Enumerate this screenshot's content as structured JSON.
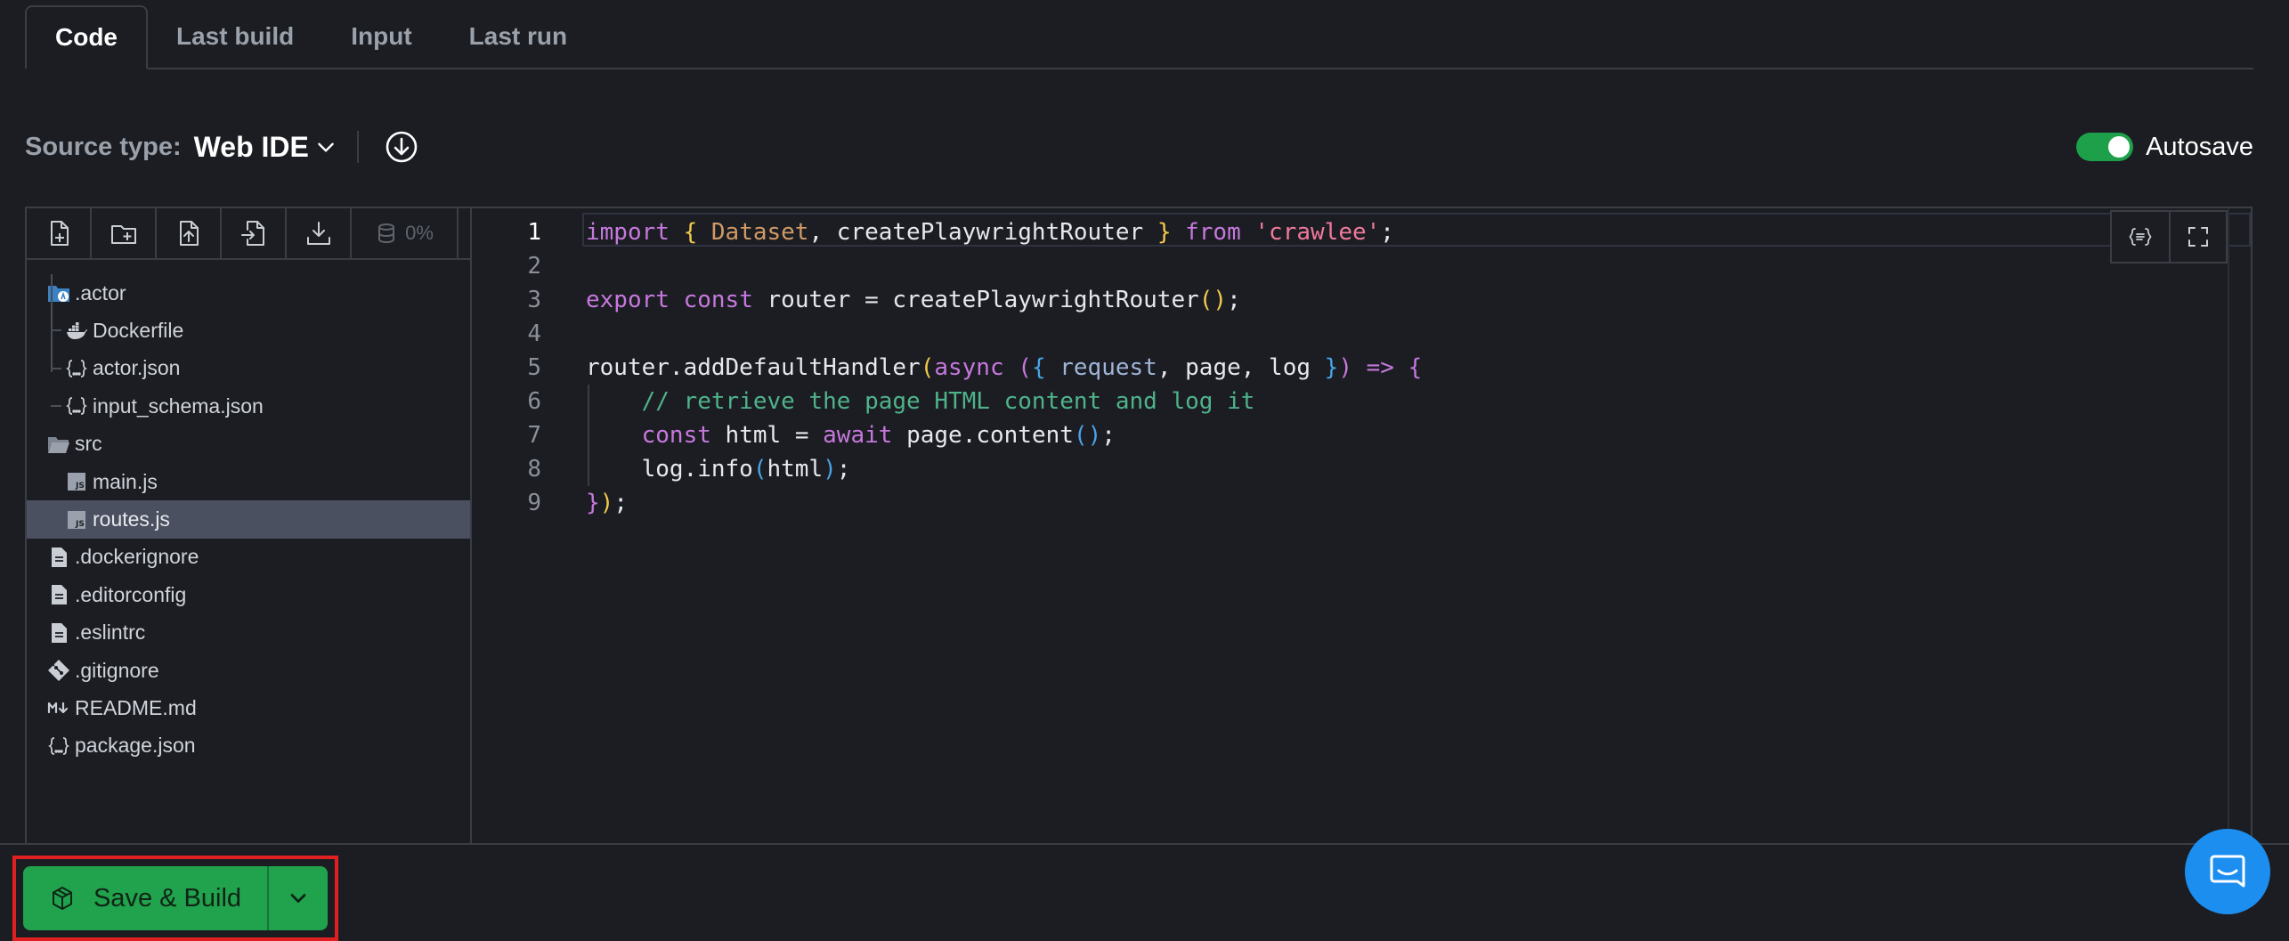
{
  "tabs": [
    {
      "label": "Code",
      "active": true
    },
    {
      "label": "Last build",
      "active": false
    },
    {
      "label": "Input",
      "active": false
    },
    {
      "label": "Last run",
      "active": false
    }
  ],
  "source": {
    "label": "Source type:",
    "value": "Web IDE",
    "download_icon": "download-circle-icon"
  },
  "autosave": {
    "label": "Autosave",
    "enabled": true,
    "color": "#1ea04b"
  },
  "file_toolbar": {
    "buttons": [
      "new-file-icon",
      "new-folder-icon",
      "upload-file-icon",
      "import-file-icon",
      "download-icon"
    ],
    "usage": "0%"
  },
  "tree": [
    {
      "name": ".actor",
      "type": "folder-actor",
      "level": 0
    },
    {
      "name": "Dockerfile",
      "type": "docker",
      "level": 1
    },
    {
      "name": "actor.json",
      "type": "json",
      "level": 1
    },
    {
      "name": "input_schema.json",
      "type": "json",
      "level": 1
    },
    {
      "name": "src",
      "type": "folder",
      "level": 0
    },
    {
      "name": "main.js",
      "type": "js",
      "level": 1
    },
    {
      "name": "routes.js",
      "type": "js",
      "level": 1,
      "selected": true
    },
    {
      "name": ".dockerignore",
      "type": "file",
      "level": 0
    },
    {
      "name": ".editorconfig",
      "type": "file",
      "level": 0
    },
    {
      "name": ".eslintrc",
      "type": "file",
      "level": 0
    },
    {
      "name": ".gitignore",
      "type": "git",
      "level": 0
    },
    {
      "name": "README.md",
      "type": "markdown",
      "level": 0
    },
    {
      "name": "package.json",
      "type": "json",
      "level": 0
    }
  ],
  "code": {
    "current_line": 1,
    "lines": [
      "import { Dataset, createPlaywrightRouter } from 'crawlee';",
      "",
      "export const router = createPlaywrightRouter();",
      "",
      "router.addDefaultHandler(async ({ request, page, log }) => {",
      "    // retrieve the page HTML content and log it",
      "    const html = await page.content();",
      "    log.info(html);",
      "});"
    ]
  },
  "editor_tools": [
    "format-icon",
    "fullscreen-icon"
  ],
  "build": {
    "label": "Save & Build",
    "icon": "cube-icon",
    "color": "#21a24c",
    "highlight": "#e02020"
  },
  "chat": {
    "icon": "chat-icon",
    "color": "#1c8ef0"
  }
}
